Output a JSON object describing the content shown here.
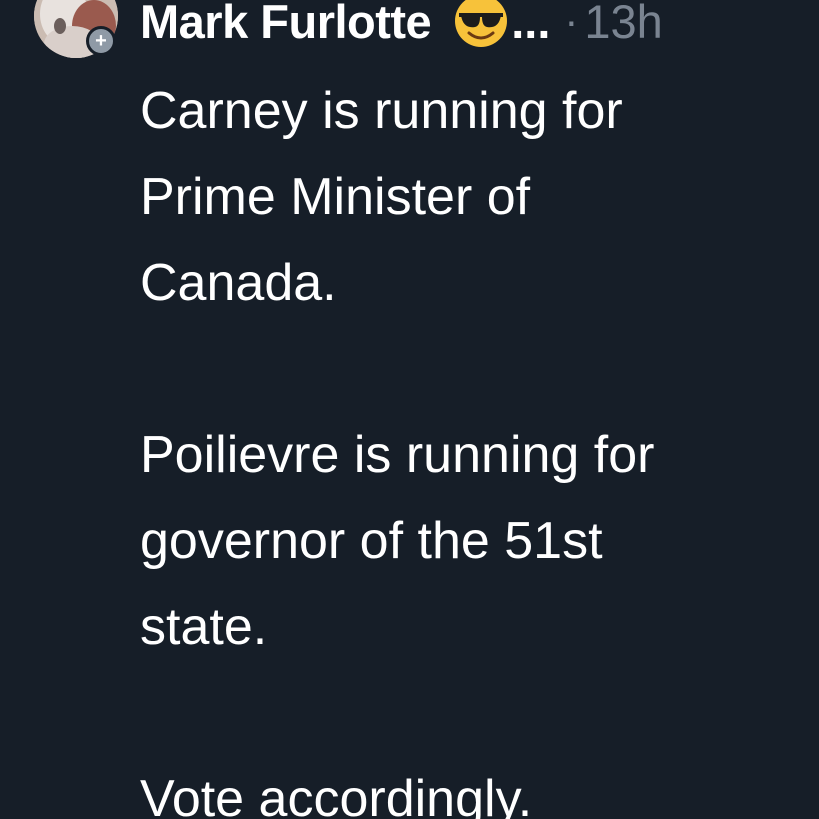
{
  "post": {
    "author": {
      "name": "Mark Furlotte",
      "truncation": "...",
      "emoji_icon": "smiling-face-with-sunglasses-icon",
      "follow_badge": "+"
    },
    "separator": "·",
    "timestamp": "13h",
    "paragraphs": [
      "Carney is running for\nPrime Minister of\nCanada.",
      "Poilievre is running for\ngovernor of the 51st\nstate.",
      "Vote accordingly."
    ]
  },
  "colors": {
    "background": "#161e28",
    "text": "#ffffff",
    "muted": "#7a8491"
  }
}
